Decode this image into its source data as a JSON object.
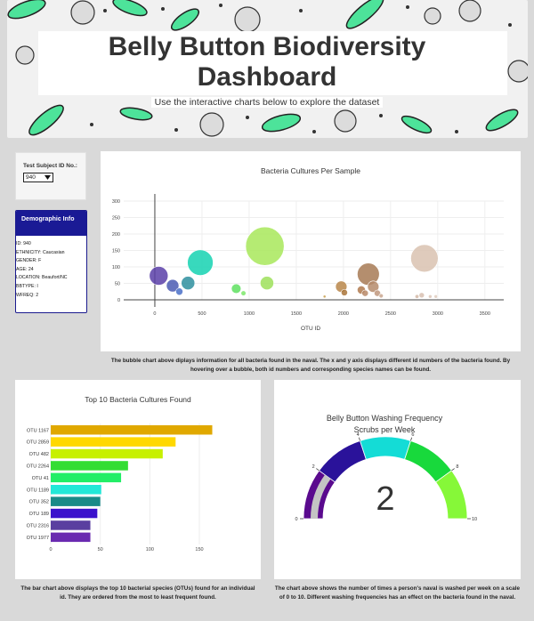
{
  "header": {
    "title": "Belly Button Biodiversity Dashboard",
    "subtitle": "Use the interactive charts below to explore the dataset"
  },
  "selector": {
    "label": "Test Subject ID No.:",
    "value": "940"
  },
  "demographics": {
    "title": "Demographic Info",
    "lines": [
      "ID: 940",
      "ETHNICITY: Caucasian",
      "GENDER: F",
      "AGE: 24",
      "LOCATION: Beaufort/NC",
      "BBTYPE: I",
      "WFREQ: 2"
    ]
  },
  "captions": {
    "bubble": "The bubble chart above diplays information for all bacteria found in the naval. The x and y axis displays different id numbers of the bacteria found. By hovering over a bubble, both id numbers and corresponding species names can be found.",
    "bar": "The bar chart above displays the top 10 bacterial species (OTUs) found for an individual id. They are ordered from the most to least frequent found.",
    "gauge": "The chart above shows the number of times a person's naval is washed per week on a scale of 0 to 10. Different washing frequencies has an effect on the bacteria found in the naval."
  },
  "chart_data": [
    {
      "type": "scatter",
      "title": "Bacteria Cultures Per Sample",
      "xlabel": "OTU ID",
      "ylabel": "",
      "xlim": [
        -330,
        3700
      ],
      "ylim": [
        0,
        300
      ],
      "xticks": [
        0,
        500,
        1000,
        1500,
        2000,
        2500,
        3000,
        3500
      ],
      "yticks": [
        0,
        50,
        100,
        150,
        200,
        250,
        300
      ],
      "points": [
        {
          "x": 41,
          "y": 73,
          "r": 10.5,
          "color": "#5b3fa8"
        },
        {
          "x": 189,
          "y": 43,
          "r": 7,
          "color": "#4a5bb3"
        },
        {
          "x": 352,
          "y": 51,
          "r": 7.6,
          "color": "#2e8f9f"
        },
        {
          "x": 482,
          "y": 113,
          "r": 14.4,
          "color": "#15d2b2"
        },
        {
          "x": 1167,
          "y": 163,
          "r": 21.6,
          "color": "#a8e85a"
        },
        {
          "x": 1189,
          "y": 51,
          "r": 7.6,
          "color": "#9de05a"
        },
        {
          "x": 863,
          "y": 34,
          "r": 5.4,
          "color": "#5fe060"
        },
        {
          "x": 940,
          "y": 20,
          "r": 2.8,
          "color": "#7de86a"
        },
        {
          "x": 260,
          "y": 25,
          "r": 4,
          "color": "#4a70c8"
        },
        {
          "x": 1800,
          "y": 10,
          "r": 1.6,
          "color": "#c9a050"
        },
        {
          "x": 1977,
          "y": 40,
          "r": 6.4,
          "color": "#b8864a"
        },
        {
          "x": 2010,
          "y": 22,
          "r": 3.6,
          "color": "#a9743a"
        },
        {
          "x": 2190,
          "y": 30,
          "r": 4.6,
          "color": "#b07a4f"
        },
        {
          "x": 2264,
          "y": 78,
          "r": 12.4,
          "color": "#a77a55"
        },
        {
          "x": 2316,
          "y": 40,
          "r": 6.4,
          "color": "#b58b6b"
        },
        {
          "x": 2230,
          "y": 20,
          "r": 3.6,
          "color": "#b98a6a"
        },
        {
          "x": 2360,
          "y": 20,
          "r": 3.6,
          "color": "#c0977c"
        },
        {
          "x": 2400,
          "y": 12,
          "r": 2.4,
          "color": "#c9a68f"
        },
        {
          "x": 2859,
          "y": 126,
          "r": 15.4,
          "color": "#d9c2b0"
        },
        {
          "x": 2780,
          "y": 10,
          "r": 2.2,
          "color": "#d3b8a7"
        },
        {
          "x": 2830,
          "y": 14,
          "r": 3,
          "color": "#d8c0b0"
        },
        {
          "x": 2920,
          "y": 10,
          "r": 2,
          "color": "#dcc6b7"
        },
        {
          "x": 2980,
          "y": 10,
          "r": 2,
          "color": "#dfcbbd"
        }
      ]
    },
    {
      "type": "bar",
      "orientation": "horizontal",
      "title": "Top 10 Bacteria Cultures Found",
      "categories": [
        "OTU 1167",
        "OTU 2859",
        "OTU 482",
        "OTU 2264",
        "OTU 41",
        "OTU 1189",
        "OTU 352",
        "OTU 189",
        "OTU 2316",
        "OTU 1977"
      ],
      "values": [
        163,
        126,
        113,
        78,
        71,
        51,
        50,
        47,
        40,
        40
      ],
      "colors": [
        "#e0a800",
        "#ffd800",
        "#c7f000",
        "#33dd33",
        "#22ee66",
        "#22e8d8",
        "#1a8a88",
        "#3b12cc",
        "#5a3fa0",
        "#6a2ab0"
      ],
      "xlim": [
        0,
        185
      ],
      "xticks": [
        0,
        50,
        100,
        150
      ]
    },
    {
      "type": "gauge",
      "title": "Belly Button Washing Frequency",
      "subtitle": "Scrubs per Week",
      "value": 2,
      "range": [
        0,
        10
      ],
      "ticks": [
        0,
        2,
        4,
        6,
        8,
        10
      ],
      "bands": [
        {
          "from": 0,
          "to": 2,
          "color": "#5a0a8e"
        },
        {
          "from": 2,
          "to": 4,
          "color": "#2a129a"
        },
        {
          "from": 4,
          "to": 6,
          "color": "#14dcd6"
        },
        {
          "from": 6,
          "to": 8,
          "color": "#18d93c"
        },
        {
          "from": 8,
          "to": 10,
          "color": "#86f838"
        }
      ],
      "value_bar_color": "#c4c4c4"
    }
  ]
}
